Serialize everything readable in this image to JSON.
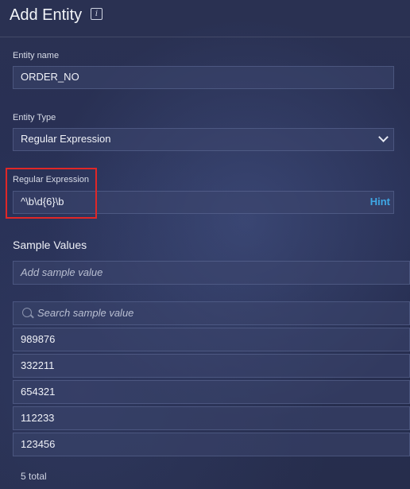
{
  "header": {
    "title": "Add Entity",
    "info_icon": "info-icon"
  },
  "entity_name": {
    "label": "Entity name",
    "value": "ORDER_NO"
  },
  "entity_type": {
    "label": "Entity Type",
    "selected": "Regular Expression"
  },
  "regex": {
    "label": "Regular Expression",
    "value": "^\\b\\d{6}\\b",
    "hint_label": "Hint"
  },
  "sample_values": {
    "title": "Sample Values",
    "add_placeholder": "Add sample value",
    "search_placeholder": "Search sample value",
    "items": [
      "989876",
      "332211",
      "654321",
      "112233",
      "123456"
    ],
    "total_label": "5 total"
  },
  "colors": {
    "accent": "#3fa8e6",
    "highlight": "#e02727",
    "background": "#283055"
  }
}
